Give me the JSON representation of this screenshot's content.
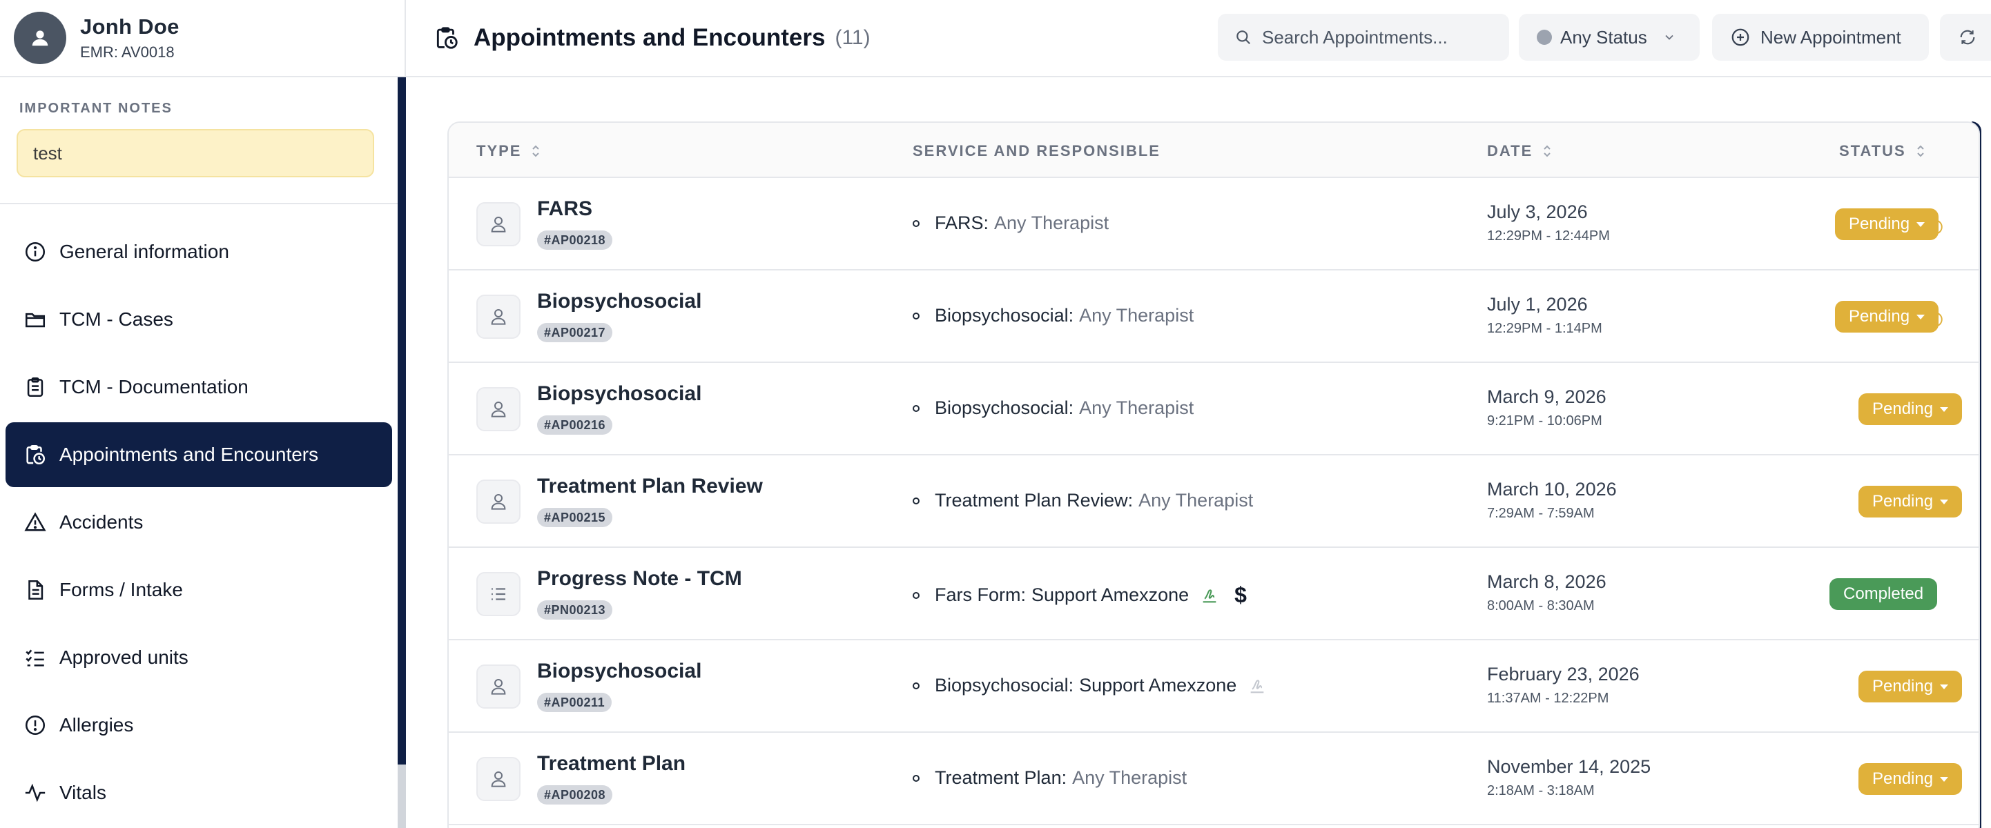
{
  "patient": {
    "name": "Jonh Doe",
    "emr": "EMR: AV0018"
  },
  "notes": {
    "title": "IMPORTANT NOTES",
    "text": "test"
  },
  "nav": [
    {
      "label": "General information",
      "icon": "info-circle-icon"
    },
    {
      "label": "TCM - Cases",
      "icon": "folder-icon"
    },
    {
      "label": "TCM - Documentation",
      "icon": "clipboard-icon"
    },
    {
      "label": "Appointments and Encounters",
      "icon": "calendar-clock-icon",
      "active": true
    },
    {
      "label": "Accidents",
      "icon": "warning-icon"
    },
    {
      "label": "Forms / Intake",
      "icon": "document-icon"
    },
    {
      "label": "Approved units",
      "icon": "checklist-icon"
    },
    {
      "label": "Allergies",
      "icon": "alert-circle-icon"
    },
    {
      "label": "Vitals",
      "icon": "pulse-icon"
    }
  ],
  "header": {
    "title": "Appointments and Encounters",
    "count": "(11)",
    "search_placeholder": "Search Appointments...",
    "status_filter": "Any Status",
    "new_button": "New Appointment"
  },
  "table": {
    "columns": {
      "type": "TYPE",
      "service": "SERVICE AND RESPONSIBLE",
      "date": "DATE",
      "status": "STATUS"
    },
    "rows": [
      {
        "type": "FARS",
        "code": "#AP00218",
        "service": "FARS:",
        "responsible": "Any Therapist",
        "date": "July 3, 2026",
        "time": "12:29PM - 12:44PM",
        "status": "Pending",
        "info": true
      },
      {
        "type": "Biopsychosocial",
        "code": "#AP00217",
        "service": "Biopsychosocial:",
        "responsible": "Any Therapist",
        "date": "July 1, 2026",
        "time": "12:29PM - 1:14PM",
        "status": "Pending",
        "info": true
      },
      {
        "type": "Biopsychosocial",
        "code": "#AP00216",
        "service": "Biopsychosocial:",
        "responsible": "Any Therapist",
        "date": "March 9, 2026",
        "time": "9:21PM - 10:06PM",
        "status": "Pending"
      },
      {
        "type": "Treatment Plan Review",
        "code": "#AP00215",
        "service": "Treatment Plan Review:",
        "responsible": "Any Therapist",
        "date": "March 10, 2026",
        "time": "7:29AM - 7:59AM",
        "status": "Pending"
      },
      {
        "type": "Progress Note - TCM",
        "code": "#PN00213",
        "service": "Fars Form:",
        "responsible": "Support Amexzone",
        "date": "March 8, 2026",
        "time": "8:00AM - 8:30AM",
        "status": "Completed",
        "signature": "signed",
        "billing": "$"
      },
      {
        "type": "Biopsychosocial",
        "code": "#AP00211",
        "service": "Biopsychosocial:",
        "responsible": "Support Amexzone",
        "date": "February 23, 2026",
        "time": "11:37AM - 12:22PM",
        "status": "Pending",
        "signature": "unsigned"
      },
      {
        "type": "Treatment Plan",
        "code": "#AP00208",
        "service": "Treatment Plan:",
        "responsible": "Any Therapist",
        "date": "November 14, 2025",
        "time": "2:18AM - 3:18AM",
        "status": "Pending"
      }
    ]
  },
  "colors": {
    "primary": "#0f1f45",
    "pending": "#e0b13a",
    "completed": "#4a9a58",
    "note_bg": "#fdf2c8"
  }
}
